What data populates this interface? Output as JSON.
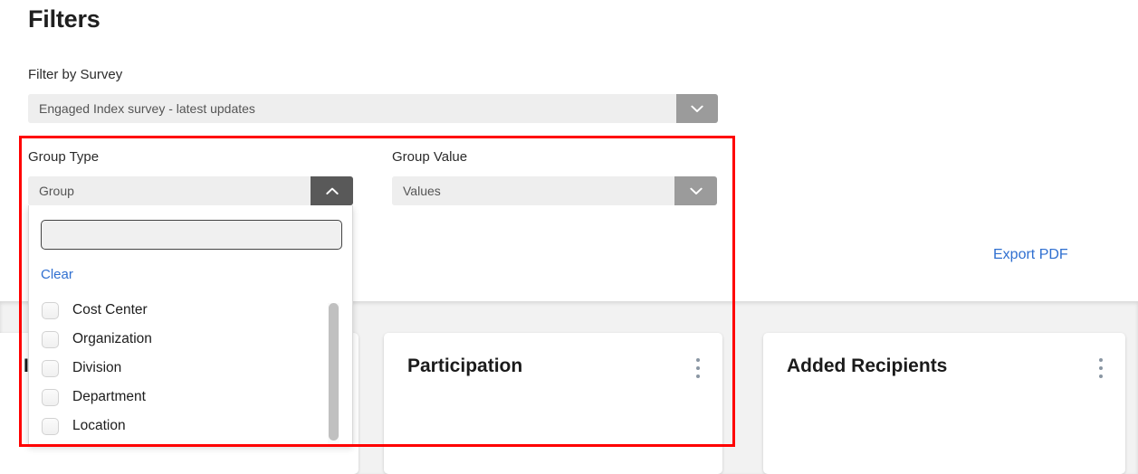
{
  "page": {
    "title": "Filters"
  },
  "filters": {
    "survey": {
      "label": "Filter by Survey",
      "value": "Engaged Index survey - latest updates",
      "chevron_icon": "chevron-down-icon"
    },
    "group_type": {
      "label": "Group Type",
      "value": "Group",
      "chevron_icon": "chevron-up-icon",
      "expanded": true,
      "dropdown": {
        "search_value": "",
        "search_placeholder": "",
        "clear_label": "Clear",
        "options": [
          {
            "label": "Cost Center",
            "checked": false
          },
          {
            "label": "Organization",
            "checked": false
          },
          {
            "label": "Division",
            "checked": false
          },
          {
            "label": "Department",
            "checked": false
          },
          {
            "label": "Location",
            "checked": false
          }
        ]
      }
    },
    "group_value": {
      "label": "Group Value",
      "value": "Values",
      "chevron_icon": "chevron-down-icon"
    }
  },
  "toolbar": {
    "export_label": "Export PDF"
  },
  "dashboard": {
    "cards": [
      {
        "title": "",
        "menu_icon": "kebab-menu-icon"
      },
      {
        "title": "Participation",
        "menu_icon": "kebab-menu-icon"
      },
      {
        "title": "Added Recipients",
        "menu_icon": "kebab-menu-icon"
      }
    ],
    "partial_card_glyph": "I"
  },
  "annotation": {
    "color": "#ff0000"
  }
}
